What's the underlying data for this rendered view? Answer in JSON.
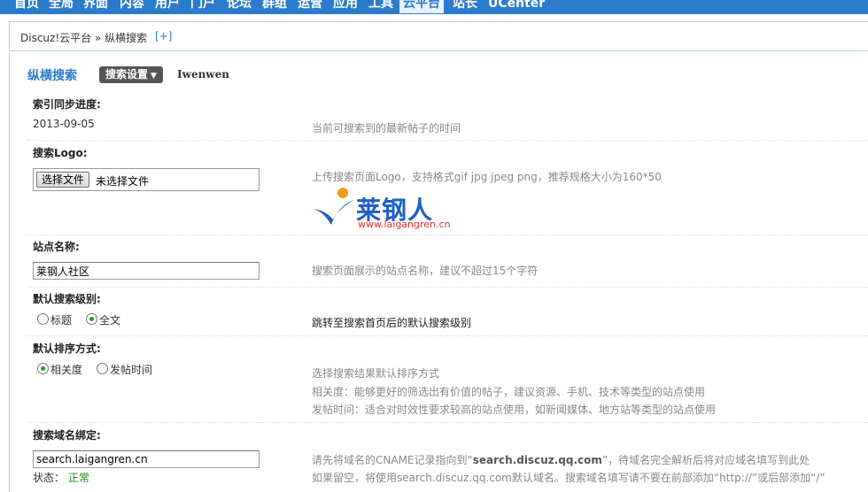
{
  "topnav": {
    "tabs": [
      {
        "label": "首页"
      },
      {
        "label": "全局"
      },
      {
        "label": "界面"
      },
      {
        "label": "内容"
      },
      {
        "label": "用户"
      },
      {
        "label": "门户"
      },
      {
        "label": "论坛"
      },
      {
        "label": "群组"
      },
      {
        "label": "运营"
      },
      {
        "label": "应用"
      },
      {
        "label": "工具"
      },
      {
        "label": "云平台"
      },
      {
        "label": "站长"
      },
      {
        "label": "UCenter"
      }
    ],
    "active": "云平台"
  },
  "breadcrumb": {
    "text": "Discuz!云平台 » 纵横搜索",
    "plus": "[+]"
  },
  "header": {
    "title": "纵横搜索",
    "menu_button": "搜索设置",
    "menu_caret": "▼",
    "subtitle": "Iwenwen"
  },
  "fields": {
    "progress": {
      "label": "索引同步进度:",
      "value": "2013-09-05",
      "tip": "当前可搜索到的最新帖子的时间"
    },
    "logo": {
      "label": "搜索Logo:",
      "button": "选择文件",
      "file_status": "未选择文件",
      "tip": "上传搜索页面Logo，支持格式gif jpg jpeg png，推荐规格大小为160*50",
      "logo_text": "莱钢人",
      "logo_url": "www.laigangren.cn"
    },
    "site_name": {
      "label": "站点名称:",
      "value": "莱钢人社区",
      "tip": "搜索页面展示的站点名称，建议不超过15个字符"
    },
    "search_level": {
      "label": "默认搜索级别:",
      "options": [
        {
          "label": "标题",
          "checked": false
        },
        {
          "label": "全文",
          "checked": true
        }
      ],
      "tip": "跳转至搜索首页后的默认搜索级别"
    },
    "sort": {
      "label": "默认排序方式:",
      "options": [
        {
          "label": "相关度",
          "checked": true
        },
        {
          "label": "发帖时间",
          "checked": false
        }
      ],
      "tips": [
        "选择搜索结果默认排序方式",
        "相关度：能够更好的筛选出有价值的帖子，建议资源、手机、技术等类型的站点使用",
        "发帖时间：适合对时效性要求较高的站点使用，如新闻媒体、地方站等类型的站点使用"
      ]
    },
    "domain": {
      "label": "搜索域名绑定:",
      "value": "search.laigangren.cn",
      "status_label": "状态：",
      "status_value": "正常",
      "tip1_pre": "请先将域名的CNAME记录指向到“",
      "tip1_strong": "search.discuz.qq.com",
      "tip1_post": "”，待域名完全解析后将对应域名填写到此处",
      "tip2": "如果留空，将使用search.discuz.qq.com默认域名。搜索域名填写请不要在前部添加“http://”或后部添加“/”"
    }
  },
  "colors": {
    "nav_bg": "#2b7acb",
    "accent": "#2b7acb",
    "status_ok": "#1d8a1d"
  }
}
